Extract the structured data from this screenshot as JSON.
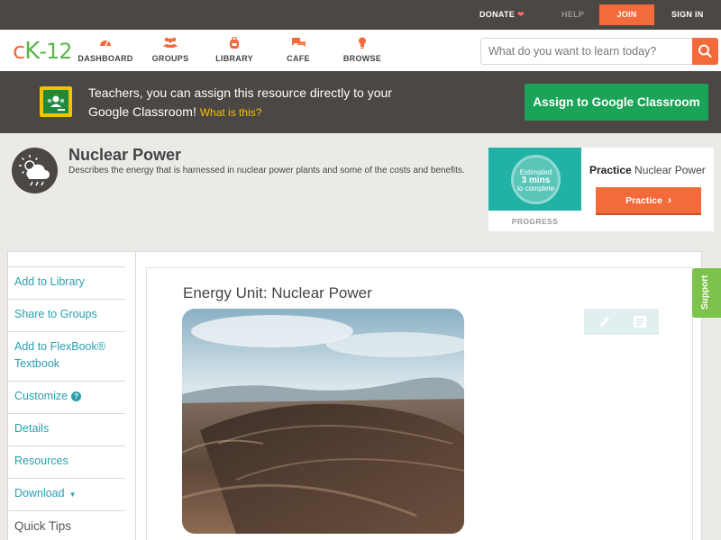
{
  "topbar": {
    "donate": "DONATE",
    "help": "HELP",
    "join": "JOIN",
    "signin": "SIGN IN"
  },
  "nav": {
    "logo": {
      "c": "c",
      "k": "K",
      "num": "-12"
    },
    "items": [
      {
        "label": "DASHBOARD",
        "icon": "dashboard-gauge-icon"
      },
      {
        "label": "GROUPS",
        "icon": "groups-people-icon"
      },
      {
        "label": "LIBRARY",
        "icon": "library-backpack-icon"
      },
      {
        "label": "CAFE",
        "icon": "cafe-chat-bubbles-icon"
      },
      {
        "label": "BROWSE",
        "icon": "browse-lightbulb-icon"
      }
    ],
    "search_placeholder": "What do you want to learn today?"
  },
  "google_banner": {
    "text": "Teachers, you can assign this resource directly to your Google Classroom!",
    "link": "What is this?",
    "button": "Assign to Google Classroom"
  },
  "concept": {
    "title": "Nuclear Power",
    "description": "Describes the energy that is harnessed in nuclear power plants and some of the costs and benefits.",
    "icon": "weather-cloud-sun-rain-icon"
  },
  "progress": {
    "estimated_line1": "Estimated",
    "estimated_big": "3 mins",
    "estimated_line3": "to complete",
    "label": "PROGRESS",
    "practice_bold": "Practice",
    "practice_rest": "Nuclear Power",
    "practice_button": "Practice"
  },
  "sidebar": {
    "items": [
      "Add to Library",
      "Share to Groups",
      "Add to FlexBook® Textbook",
      "Customize",
      "Details",
      "Resources",
      "Download"
    ],
    "quick_tips": "Quick Tips"
  },
  "article": {
    "title": "Energy Unit: Nuclear Power",
    "image_alt": "aerial view of desert mountains"
  },
  "support": "Support",
  "colors": {
    "brand_orange": "#f36a3b",
    "brand_green": "#5ab54b",
    "link_teal": "#2a9fb0",
    "dark_bar": "#4a4745",
    "google_green": "#1ba358"
  }
}
